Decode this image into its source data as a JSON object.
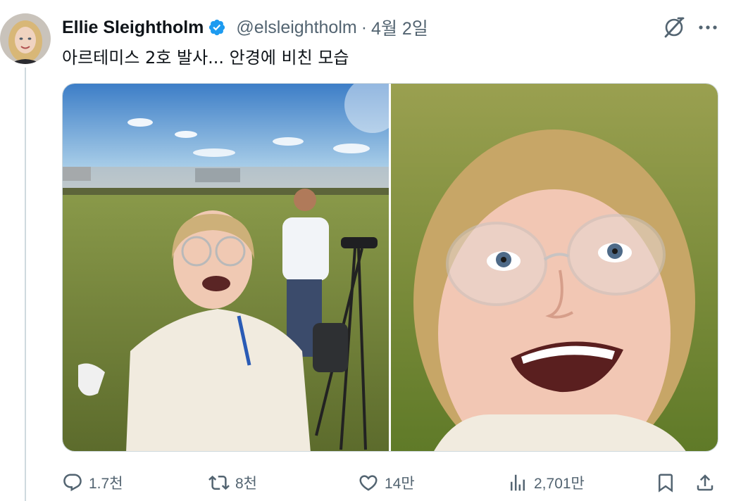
{
  "author": {
    "name": "Ellie Sleightholm",
    "handle": "@elsleightholm",
    "separator": "·",
    "date": "4월 2일",
    "verified": true
  },
  "tweet": {
    "text": "아르테미스 2호 발사... 안경에 비친 모습"
  },
  "actions": {
    "reply_count": "1.7천",
    "retweet_count": "8천",
    "like_count": "14만",
    "views_count": "2,701만"
  },
  "icons": {
    "verified": "verified-badge-icon",
    "grok": "grok-icon",
    "more": "more-icon",
    "reply": "reply-icon",
    "retweet": "retweet-icon",
    "like": "heart-icon",
    "views": "views-icon",
    "bookmark": "bookmark-icon",
    "share": "share-icon"
  },
  "colors": {
    "verified": "#1d9bf0",
    "secondary_text": "#536471",
    "primary_text": "#0f1419",
    "thread_line": "#cfd9de"
  }
}
